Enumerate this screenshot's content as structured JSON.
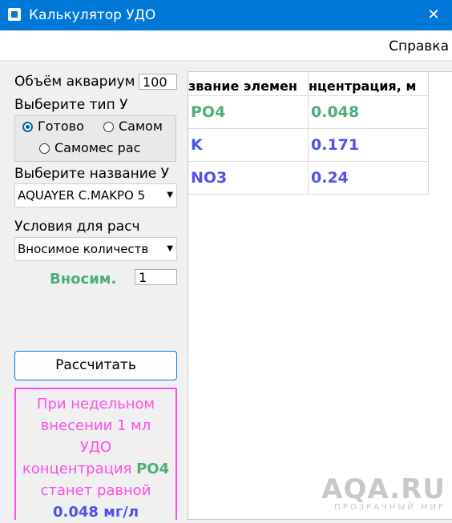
{
  "window": {
    "title": "Калькулятор УДО",
    "close_symbol": "✕"
  },
  "menu": {
    "help": "Справка"
  },
  "volume": {
    "label": "Объём аквариум",
    "value": "100"
  },
  "type_group": {
    "label": "Выберите тип У",
    "options": [
      "Готово",
      "Самом",
      "Самомес рас"
    ],
    "selected_index": 0
  },
  "name_select": {
    "label": "Выберите название У",
    "value": "AQUAYER C.MAKPO 5"
  },
  "conditions": {
    "label": "Условия для расч",
    "value": "Вносимое количеств"
  },
  "amount": {
    "label": "Вносим.",
    "value": "1"
  },
  "calculate_button": "Рассчитать",
  "result": {
    "line1": "При недельном",
    "line2": "внесении 1 мл",
    "line3": "УДО",
    "line4_prefix": "концентрация",
    "element": "PO4",
    "line5": "станет равной",
    "value": "0.048 мг/л"
  },
  "table": {
    "headers": [
      "звание элемен",
      "нцентрация, м"
    ],
    "rows": [
      {
        "element": "PO4",
        "value": "0.048",
        "color": "#4caf7a"
      },
      {
        "element": "K",
        "value": "0.171",
        "color": "#5050ee"
      },
      {
        "element": "NO3",
        "value": "0.24",
        "color": "#5050ee"
      }
    ]
  },
  "watermark": {
    "main": "AQA.RU",
    "sub": "ПРОЗРАЧНЫЙ МИР"
  },
  "colors": {
    "titlebar": "#0078d7",
    "green": "#4caf7a",
    "blue": "#5050ee",
    "pink": "#ff4fe6"
  }
}
